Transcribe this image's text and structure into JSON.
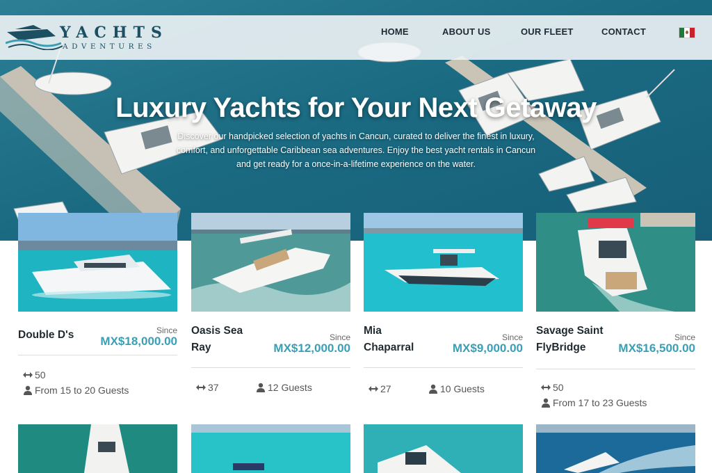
{
  "brand": {
    "name_line1": "YACHTS",
    "name_line2": "ADVENTURES",
    "colors": {
      "primary": "#1d4f63",
      "accent": "#3a9fb5",
      "sea": "#1b6e86"
    }
  },
  "nav": {
    "items": [
      {
        "label": "HOME"
      },
      {
        "label": "ABOUT US"
      },
      {
        "label": "OUR FLEET"
      },
      {
        "label": "CONTACT"
      }
    ],
    "language_icon": "mexico-flag-icon"
  },
  "hero": {
    "title": "Luxury Yachts for Your Next Getaway",
    "text": "Discover our handpicked selection of yachts in Cancun, curated to deliver the finest in luxury, comfort, and unforgettable Caribbean sea adventures. Enjoy the best yacht rentals in Cancun and get ready for a once-in-a-lifetime experience on the water."
  },
  "cards": [
    {
      "name": "Double D's",
      "since": "Since",
      "price": "MX$18,000.00",
      "length": "50",
      "guests": "From 15 to 20 Guests"
    },
    {
      "name": "Oasis Sea Ray",
      "since": "Since",
      "price": "MX$12,000.00",
      "length": "37",
      "guests": "12 Guests"
    },
    {
      "name": "Mia Chaparral",
      "since": "Since",
      "price": "MX$9,000.00",
      "length": "27",
      "guests": "10 Guests"
    },
    {
      "name": "Savage Saint FlyBridge",
      "since": "Since",
      "price": "MX$16,500.00",
      "length": "50",
      "guests": "From 17 to 23 Guests"
    }
  ],
  "icons": {
    "length": "arrows-horizontal-icon",
    "guests": "person-icon"
  }
}
